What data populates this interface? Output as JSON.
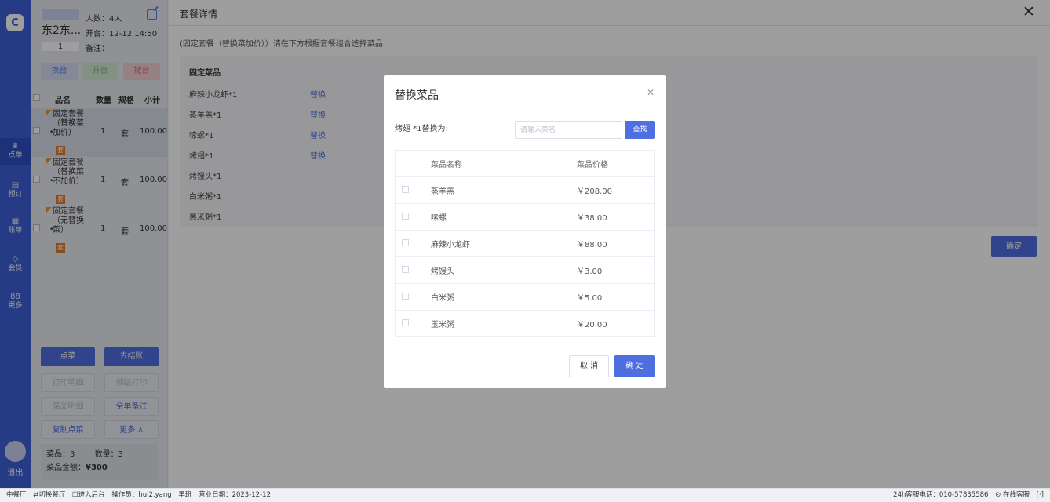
{
  "rail": {
    "items": [
      {
        "icon": "food-icon",
        "glyph": "♛",
        "label": "点单"
      },
      {
        "icon": "book-icon",
        "glyph": "▤",
        "label": "预订"
      },
      {
        "icon": "bill-icon",
        "glyph": "▦",
        "label": "账单"
      },
      {
        "icon": "member-icon",
        "glyph": "◇",
        "label": "会员"
      },
      {
        "icon": "more-icon",
        "glyph": "88",
        "label": "更多"
      }
    ],
    "logout": "退出"
  },
  "table": {
    "name": "东2东...",
    "number": "1",
    "people": "人数：4人",
    "opened": "开台：12-12 14:50",
    "note": "备注："
  },
  "side_buttons": {
    "change": "换台",
    "open": "开台",
    "cancel": "撤台"
  },
  "order_header": {
    "name": "品名",
    "qty": "数量",
    "unit": "规格",
    "subtotal": "小计"
  },
  "orders": [
    {
      "name": "固定套餐（替换菜加价）",
      "tag": "套",
      "qty": "1",
      "unit": "套",
      "price": "100.00"
    },
    {
      "name": "固定套餐（替换菜不加价）",
      "tag": "套",
      "qty": "1",
      "unit": "套",
      "price": "100.00"
    },
    {
      "name": "固定套餐（无替换菜）",
      "tag": "套",
      "qty": "1",
      "unit": "套",
      "price": "100.00"
    }
  ],
  "actions": {
    "order": "点菜",
    "checkout": "去结账",
    "print_detail": "打印明细",
    "pre_print": "预结打印",
    "dish_detail": "菜品明细",
    "order_note": "全单备注",
    "copy_order": "复制点菜",
    "more": "更多 ∧"
  },
  "summary": {
    "dishes": "菜品：3",
    "count": "数量：3",
    "amount_label": "菜品金额：",
    "amount": "¥300"
  },
  "detail": {
    "title": "套餐详情",
    "hint": "(固定套餐（替换菜加价））请在下方根据套餐组合选择菜品",
    "section": "固定菜品",
    "items": [
      {
        "name": "麻辣小龙虾*1",
        "replace": "替换"
      },
      {
        "name": "蒸羊羔*1",
        "replace": "替换"
      },
      {
        "name": "嗦螺*1",
        "replace": "替换"
      },
      {
        "name": "烤翅*1",
        "replace": "替换"
      },
      {
        "name": "烤馒头*1",
        "replace": ""
      },
      {
        "name": "白米粥*1",
        "replace": ""
      },
      {
        "name": "黑米粥*1",
        "replace": ""
      }
    ],
    "confirm": "确定"
  },
  "modal": {
    "title": "替换菜品",
    "replace_label": "烤翅 *1替换为:",
    "search_placeholder": "请输入菜名",
    "search_button": "查找",
    "col_name": "菜品名称",
    "col_price": "菜品价格",
    "rows": [
      {
        "name": "蒸羊羔",
        "price": "￥208.00"
      },
      {
        "name": "嗦螺",
        "price": "￥38.00"
      },
      {
        "name": "麻辣小龙虾",
        "price": "￥88.00"
      },
      {
        "name": "烤馒头",
        "price": "￥3.00"
      },
      {
        "name": "白米粥",
        "price": "￥5.00"
      },
      {
        "name": "玉米粥",
        "price": "￥20.00"
      }
    ],
    "cancel": "取 消",
    "ok": "确 定"
  },
  "status": {
    "restaurant": "中餐厅",
    "switch": "⇄切换餐厅",
    "backend": "☐进入后台",
    "operator": "操作员：hui2.yang",
    "shift": "早班",
    "date": "营业日期：2023-12-12",
    "hotline": "24h客服电话：010-57835586",
    "service": "⊙ 在线客服",
    "fullscreen": "[·]"
  }
}
